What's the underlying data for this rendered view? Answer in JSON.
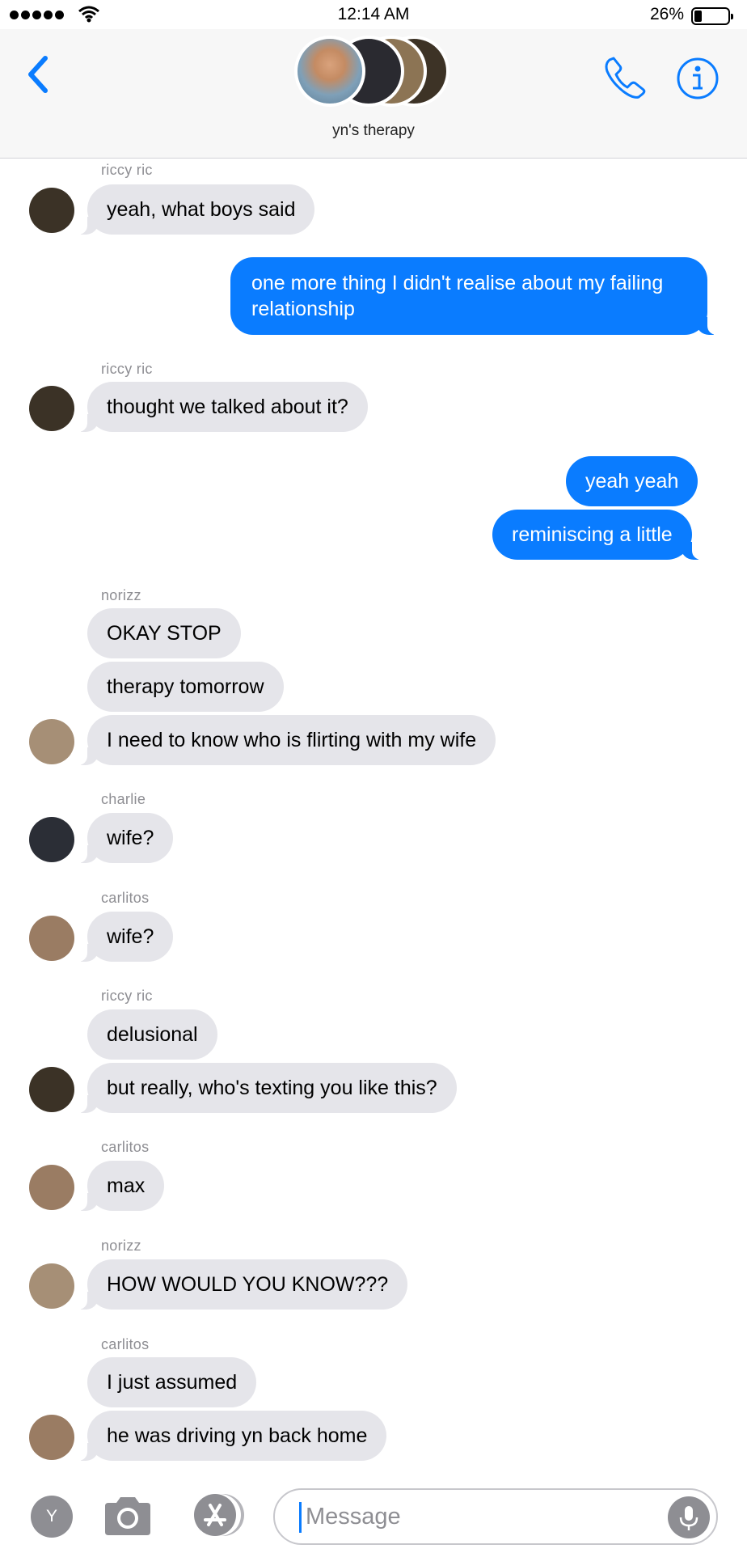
{
  "status": {
    "time": "12:14 AM",
    "battery": "26%"
  },
  "header": {
    "title": "yn's therapy"
  },
  "messages": [
    {
      "sender": "riccy ric"
    },
    {
      "text": "yeah, what boys said"
    },
    {
      "text": "one more thing I didn't realise about my failing relationship"
    },
    {
      "sender": "riccy ric"
    },
    {
      "text": "thought we talked about it?"
    },
    {
      "text": "yeah yeah"
    },
    {
      "text": "reminiscing a little"
    },
    {
      "sender": "norizz"
    },
    {
      "text": "OKAY STOP"
    },
    {
      "text": "therapy tomorrow"
    },
    {
      "text": "I need to know who is flirting with my wife"
    },
    {
      "sender": "charlie"
    },
    {
      "text": "wife?"
    },
    {
      "sender": "carlitos"
    },
    {
      "text": "wife?"
    },
    {
      "sender": "riccy ric"
    },
    {
      "text": "delusional"
    },
    {
      "text": "but really, who's texting you like this?"
    },
    {
      "sender": "carlitos"
    },
    {
      "text": "max"
    },
    {
      "sender": "norizz"
    },
    {
      "text": "HOW WOULD YOU KNOW???"
    },
    {
      "sender": "carlitos"
    },
    {
      "text": "I just assumed"
    },
    {
      "text": "he was driving yn back home"
    }
  ],
  "composer": {
    "avatar_letter": "Y",
    "placeholder": "Message"
  },
  "colors": {
    "accent": "#0a7cff",
    "incoming": "#e5e5ea",
    "meta": "#8e8e93"
  },
  "icons": [
    "back-chevron-icon",
    "phone-icon",
    "info-icon",
    "camera-icon",
    "app-store-icon",
    "microphone-icon",
    "wifi-icon",
    "battery-icon"
  ]
}
